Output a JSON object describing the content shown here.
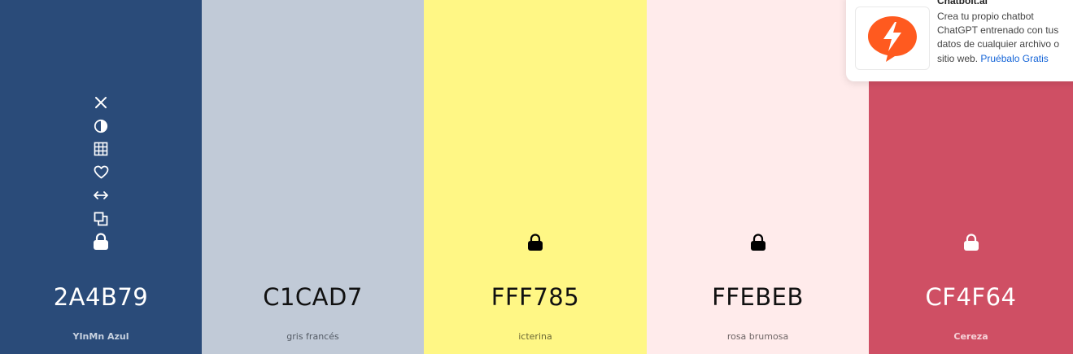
{
  "swatches": [
    {
      "hex": "2A4B79",
      "name": "YInMn Azul",
      "bg": "#2A4B79",
      "fg": "#ffffff",
      "name_color": "#c8d2e0",
      "locked": false,
      "show_tools": true
    },
    {
      "hex": "C1CAD7",
      "name": "gris francés",
      "bg": "#C1CAD7",
      "fg": "#111111",
      "name_color": "#555c66",
      "locked": false,
      "show_tools": false
    },
    {
      "hex": "FFF785",
      "name": "icterina",
      "bg": "#FFF785",
      "fg": "#111111",
      "name_color": "#6b6836",
      "locked": true,
      "show_tools": false
    },
    {
      "hex": "FFEBEB",
      "name": "rosa brumosa",
      "bg": "#FFEBEB",
      "fg": "#111111",
      "name_color": "#6f6666",
      "locked": true,
      "show_tools": false
    },
    {
      "hex": "CF4F64",
      "name": "Cereza",
      "bg": "#CF4F64",
      "fg": "#ffffff",
      "name_color": "#f6d3d9",
      "locked": true,
      "show_tools": false
    }
  ],
  "tools": [
    "close-icon",
    "contrast-icon",
    "shades-grid-icon",
    "heart-icon",
    "drag-arrows-icon",
    "copy-icon",
    "lock-icon"
  ],
  "ad": {
    "title": "Chatbolt.ai",
    "text": "Crea tu propio chatbot ChatGPT entrenado con tus datos de cualquier archivo o sitio web.",
    "link": "Pruébalo Gratis",
    "logo_color": "#FF5A1F"
  }
}
